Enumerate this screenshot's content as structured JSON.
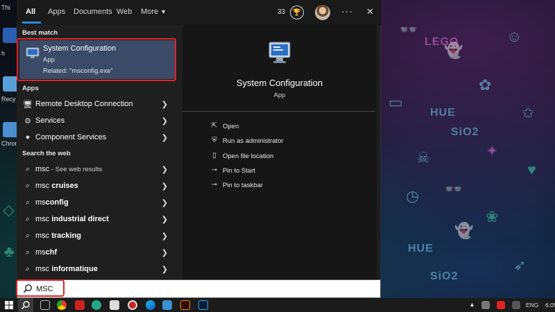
{
  "tabs": [
    {
      "label": "All"
    },
    {
      "label": "Apps"
    },
    {
      "label": "Documents"
    },
    {
      "label": "Web"
    },
    {
      "label": "More"
    }
  ],
  "header": {
    "badge_count": "33",
    "more_icon": "ellipsis-icon",
    "close_icon": "close-icon"
  },
  "sections": {
    "best_match": "Best match",
    "apps": "Apps",
    "search_web": "Search the web"
  },
  "best_match": {
    "title": "System Configuration",
    "subtitle": "App",
    "related": "Related: \"msconfig.exe\""
  },
  "apps": [
    {
      "label": "Remote Desktop Connection",
      "icon": "remote-desktop-icon"
    },
    {
      "label": "Services",
      "icon": "services-gear-icon"
    },
    {
      "label": "Component Services",
      "icon": "component-services-icon"
    }
  ],
  "web_results": [
    {
      "prefix": "msc",
      "suffix": " - See web results"
    },
    {
      "prefix": "msc ",
      "bold": "cruises"
    },
    {
      "prefix": "ms",
      "bold": "config"
    },
    {
      "prefix": "msc ",
      "bold": "industrial direct"
    },
    {
      "prefix": "msc ",
      "bold": "tracking"
    },
    {
      "prefix": "ms",
      "bold": "chf"
    },
    {
      "prefix": "msc ",
      "bold": "informatique"
    }
  ],
  "detail": {
    "title": "System Configuration",
    "subtitle": "App",
    "actions": [
      {
        "label": "Open"
      },
      {
        "label": "Run as administrator"
      },
      {
        "label": "Open file location"
      },
      {
        "label": "Pin to Start"
      },
      {
        "label": "Pin to taskbar"
      }
    ]
  },
  "search": {
    "value": "MSC"
  },
  "desktop": {
    "icon_labels": [
      "Thi",
      "h",
      "Recy",
      "Chrom"
    ],
    "wallpaper_words": [
      "HUE",
      "SiO2",
      "LEGO",
      "HUE",
      "SiO2"
    ]
  },
  "tray": {
    "lang": "ENG",
    "time": "6:05"
  },
  "colors": {
    "accent": "#2b8de4",
    "highlight": "#3b4a66",
    "annotation": "#e2222b"
  }
}
